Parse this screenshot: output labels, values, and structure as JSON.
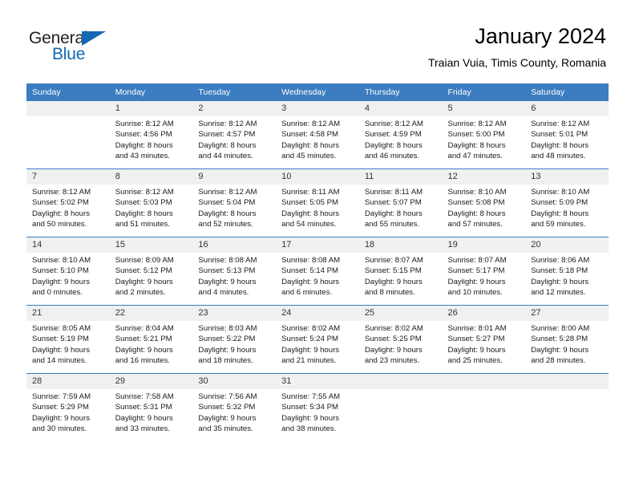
{
  "brand": {
    "line1": "General",
    "line2": "Blue",
    "triangle_color": "#1268b3",
    "text_color": "#231f20"
  },
  "header": {
    "title": "January 2024",
    "subtitle": "Traian Vuia, Timis County, Romania"
  },
  "theme": {
    "header_row_bg": "#3b7dc0",
    "header_row_text": "#ffffff",
    "daynum_bg": "#f0f0f0",
    "row_divider": "#3b7dc0",
    "body_text": "#1a1a1a",
    "page_bg": "#ffffff"
  },
  "calendar": {
    "weekday_headers": [
      "Sunday",
      "Monday",
      "Tuesday",
      "Wednesday",
      "Thursday",
      "Friday",
      "Saturday"
    ],
    "weeks": [
      [
        {
          "day": "",
          "lines": []
        },
        {
          "day": "1",
          "lines": [
            "Sunrise: 8:12 AM",
            "Sunset: 4:56 PM",
            "Daylight: 8 hours",
            "and 43 minutes."
          ]
        },
        {
          "day": "2",
          "lines": [
            "Sunrise: 8:12 AM",
            "Sunset: 4:57 PM",
            "Daylight: 8 hours",
            "and 44 minutes."
          ]
        },
        {
          "day": "3",
          "lines": [
            "Sunrise: 8:12 AM",
            "Sunset: 4:58 PM",
            "Daylight: 8 hours",
            "and 45 minutes."
          ]
        },
        {
          "day": "4",
          "lines": [
            "Sunrise: 8:12 AM",
            "Sunset: 4:59 PM",
            "Daylight: 8 hours",
            "and 46 minutes."
          ]
        },
        {
          "day": "5",
          "lines": [
            "Sunrise: 8:12 AM",
            "Sunset: 5:00 PM",
            "Daylight: 8 hours",
            "and 47 minutes."
          ]
        },
        {
          "day": "6",
          "lines": [
            "Sunrise: 8:12 AM",
            "Sunset: 5:01 PM",
            "Daylight: 8 hours",
            "and 48 minutes."
          ]
        }
      ],
      [
        {
          "day": "7",
          "lines": [
            "Sunrise: 8:12 AM",
            "Sunset: 5:02 PM",
            "Daylight: 8 hours",
            "and 50 minutes."
          ]
        },
        {
          "day": "8",
          "lines": [
            "Sunrise: 8:12 AM",
            "Sunset: 5:03 PM",
            "Daylight: 8 hours",
            "and 51 minutes."
          ]
        },
        {
          "day": "9",
          "lines": [
            "Sunrise: 8:12 AM",
            "Sunset: 5:04 PM",
            "Daylight: 8 hours",
            "and 52 minutes."
          ]
        },
        {
          "day": "10",
          "lines": [
            "Sunrise: 8:11 AM",
            "Sunset: 5:05 PM",
            "Daylight: 8 hours",
            "and 54 minutes."
          ]
        },
        {
          "day": "11",
          "lines": [
            "Sunrise: 8:11 AM",
            "Sunset: 5:07 PM",
            "Daylight: 8 hours",
            "and 55 minutes."
          ]
        },
        {
          "day": "12",
          "lines": [
            "Sunrise: 8:10 AM",
            "Sunset: 5:08 PM",
            "Daylight: 8 hours",
            "and 57 minutes."
          ]
        },
        {
          "day": "13",
          "lines": [
            "Sunrise: 8:10 AM",
            "Sunset: 5:09 PM",
            "Daylight: 8 hours",
            "and 59 minutes."
          ]
        }
      ],
      [
        {
          "day": "14",
          "lines": [
            "Sunrise: 8:10 AM",
            "Sunset: 5:10 PM",
            "Daylight: 9 hours",
            "and 0 minutes."
          ]
        },
        {
          "day": "15",
          "lines": [
            "Sunrise: 8:09 AM",
            "Sunset: 5:12 PM",
            "Daylight: 9 hours",
            "and 2 minutes."
          ]
        },
        {
          "day": "16",
          "lines": [
            "Sunrise: 8:08 AM",
            "Sunset: 5:13 PM",
            "Daylight: 9 hours",
            "and 4 minutes."
          ]
        },
        {
          "day": "17",
          "lines": [
            "Sunrise: 8:08 AM",
            "Sunset: 5:14 PM",
            "Daylight: 9 hours",
            "and 6 minutes."
          ]
        },
        {
          "day": "18",
          "lines": [
            "Sunrise: 8:07 AM",
            "Sunset: 5:15 PM",
            "Daylight: 9 hours",
            "and 8 minutes."
          ]
        },
        {
          "day": "19",
          "lines": [
            "Sunrise: 8:07 AM",
            "Sunset: 5:17 PM",
            "Daylight: 9 hours",
            "and 10 minutes."
          ]
        },
        {
          "day": "20",
          "lines": [
            "Sunrise: 8:06 AM",
            "Sunset: 5:18 PM",
            "Daylight: 9 hours",
            "and 12 minutes."
          ]
        }
      ],
      [
        {
          "day": "21",
          "lines": [
            "Sunrise: 8:05 AM",
            "Sunset: 5:19 PM",
            "Daylight: 9 hours",
            "and 14 minutes."
          ]
        },
        {
          "day": "22",
          "lines": [
            "Sunrise: 8:04 AM",
            "Sunset: 5:21 PM",
            "Daylight: 9 hours",
            "and 16 minutes."
          ]
        },
        {
          "day": "23",
          "lines": [
            "Sunrise: 8:03 AM",
            "Sunset: 5:22 PM",
            "Daylight: 9 hours",
            "and 18 minutes."
          ]
        },
        {
          "day": "24",
          "lines": [
            "Sunrise: 8:02 AM",
            "Sunset: 5:24 PM",
            "Daylight: 9 hours",
            "and 21 minutes."
          ]
        },
        {
          "day": "25",
          "lines": [
            "Sunrise: 8:02 AM",
            "Sunset: 5:25 PM",
            "Daylight: 9 hours",
            "and 23 minutes."
          ]
        },
        {
          "day": "26",
          "lines": [
            "Sunrise: 8:01 AM",
            "Sunset: 5:27 PM",
            "Daylight: 9 hours",
            "and 25 minutes."
          ]
        },
        {
          "day": "27",
          "lines": [
            "Sunrise: 8:00 AM",
            "Sunset: 5:28 PM",
            "Daylight: 9 hours",
            "and 28 minutes."
          ]
        }
      ],
      [
        {
          "day": "28",
          "lines": [
            "Sunrise: 7:59 AM",
            "Sunset: 5:29 PM",
            "Daylight: 9 hours",
            "and 30 minutes."
          ]
        },
        {
          "day": "29",
          "lines": [
            "Sunrise: 7:58 AM",
            "Sunset: 5:31 PM",
            "Daylight: 9 hours",
            "and 33 minutes."
          ]
        },
        {
          "day": "30",
          "lines": [
            "Sunrise: 7:56 AM",
            "Sunset: 5:32 PM",
            "Daylight: 9 hours",
            "and 35 minutes."
          ]
        },
        {
          "day": "31",
          "lines": [
            "Sunrise: 7:55 AM",
            "Sunset: 5:34 PM",
            "Daylight: 9 hours",
            "and 38 minutes."
          ]
        },
        {
          "day": "",
          "lines": []
        },
        {
          "day": "",
          "lines": []
        },
        {
          "day": "",
          "lines": []
        }
      ]
    ]
  }
}
